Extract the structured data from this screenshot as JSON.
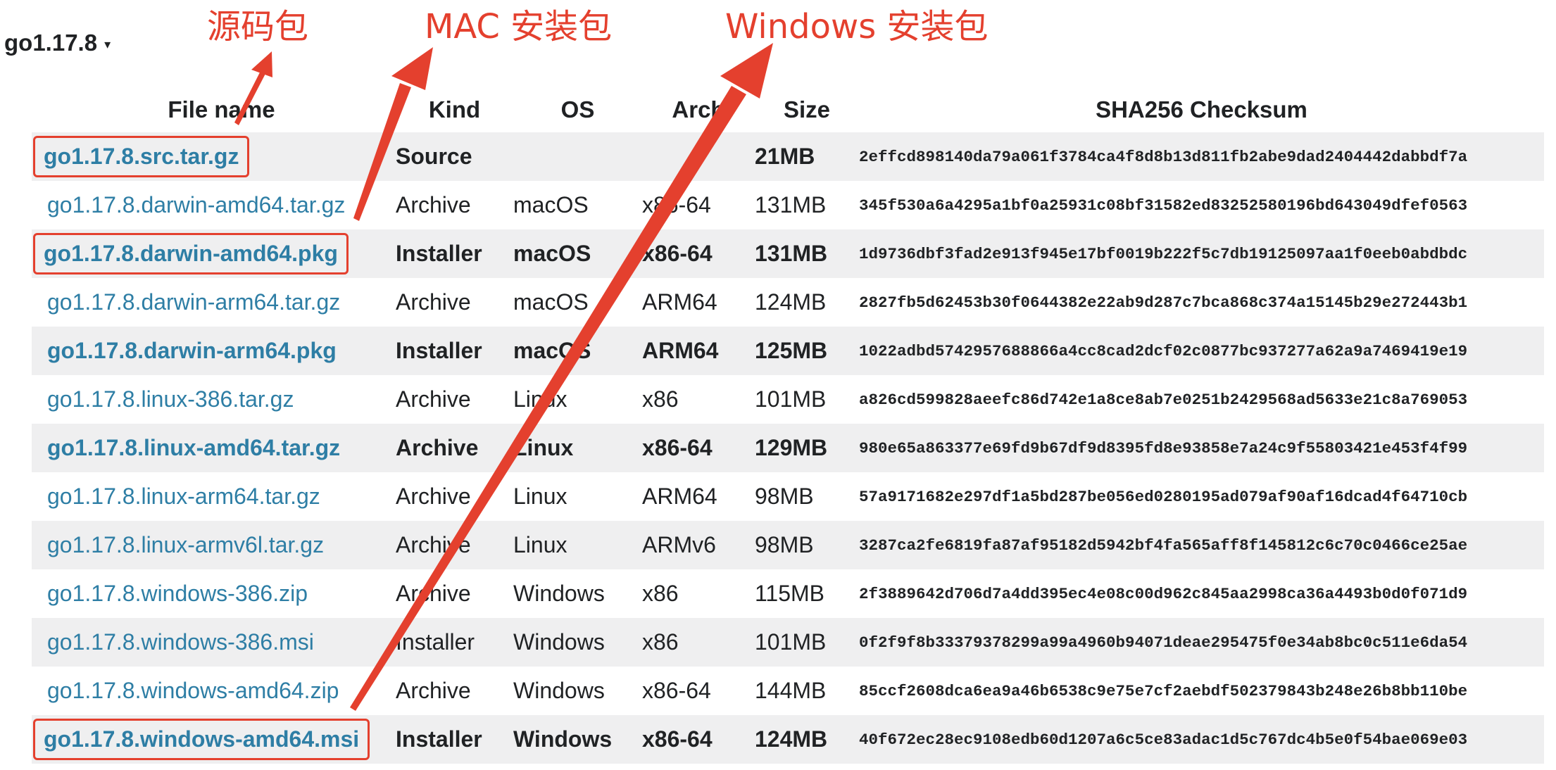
{
  "version": {
    "label": "go1.17.8",
    "caret": "▾"
  },
  "annotations": {
    "source_label": "源码包",
    "mac_label": "MAC 安装包",
    "windows_label": "Windows 安装包",
    "color": "#e4402e"
  },
  "table": {
    "headers": [
      "File name",
      "Kind",
      "OS",
      "Arch",
      "Size",
      "SHA256 Checksum"
    ],
    "rows": [
      {
        "file": "go1.17.8.src.tar.gz",
        "kind": "Source",
        "os": "",
        "arch": "",
        "size": "21MB",
        "sha": "2effcd898140da79a061f3784ca4f8d8b13d811fb2abe9dad2404442dabbdf7a"
      },
      {
        "file": "go1.17.8.darwin-amd64.tar.gz",
        "kind": "Archive",
        "os": "macOS",
        "arch": "x86-64",
        "size": "131MB",
        "sha": "345f530a6a4295a1bf0a25931c08bf31582ed83252580196bd643049dfef0563"
      },
      {
        "file": "go1.17.8.darwin-amd64.pkg",
        "kind": "Installer",
        "os": "macOS",
        "arch": "x86-64",
        "size": "131MB",
        "sha": "1d9736dbf3fad2e913f945e17bf0019b222f5c7db19125097aa1f0eeb0abdbdc"
      },
      {
        "file": "go1.17.8.darwin-arm64.tar.gz",
        "kind": "Archive",
        "os": "macOS",
        "arch": "ARM64",
        "size": "124MB",
        "sha": "2827fb5d62453b30f0644382e22ab9d287c7bca868c374a15145b29e272443b1"
      },
      {
        "file": "go1.17.8.darwin-arm64.pkg",
        "kind": "Installer",
        "os": "macOS",
        "arch": "ARM64",
        "size": "125MB",
        "sha": "1022adbd5742957688866a4cc8cad2dcf02c0877bc937277a62a9a7469419e19"
      },
      {
        "file": "go1.17.8.linux-386.tar.gz",
        "kind": "Archive",
        "os": "Linux",
        "arch": "x86",
        "size": "101MB",
        "sha": "a826cd599828aeefc86d742e1a8ce8ab7e0251b2429568ad5633e21c8a769053"
      },
      {
        "file": "go1.17.8.linux-amd64.tar.gz",
        "kind": "Archive",
        "os": "Linux",
        "arch": "x86-64",
        "size": "129MB",
        "sha": "980e65a863377e69fd9b67df9d8395fd8e93858e7a24c9f55803421e453f4f99"
      },
      {
        "file": "go1.17.8.linux-arm64.tar.gz",
        "kind": "Archive",
        "os": "Linux",
        "arch": "ARM64",
        "size": "98MB",
        "sha": "57a9171682e297df1a5bd287be056ed0280195ad079af90af16dcad4f64710cb"
      },
      {
        "file": "go1.17.8.linux-armv6l.tar.gz",
        "kind": "Archive",
        "os": "Linux",
        "arch": "ARMv6",
        "size": "98MB",
        "sha": "3287ca2fe6819fa87af95182d5942bf4fa565aff8f145812c6c70c0466ce25ae"
      },
      {
        "file": "go1.17.8.windows-386.zip",
        "kind": "Archive",
        "os": "Windows",
        "arch": "x86",
        "size": "115MB",
        "sha": "2f3889642d706d7a4dd395ec4e08c00d962c845aa2998ca36a4493b0d0f071d9"
      },
      {
        "file": "go1.17.8.windows-386.msi",
        "kind": "Installer",
        "os": "Windows",
        "arch": "x86",
        "size": "101MB",
        "sha": "0f2f9f8b33379378299a99a4960b94071deae295475f0e34ab8bc0c511e6da54"
      },
      {
        "file": "go1.17.8.windows-amd64.zip",
        "kind": "Archive",
        "os": "Windows",
        "arch": "x86-64",
        "size": "144MB",
        "sha": "85ccf2608dca6ea9a46b6538c9e75e7cf2aebdf502379843b248e26b8bb110be"
      },
      {
        "file": "go1.17.8.windows-amd64.msi",
        "kind": "Installer",
        "os": "Windows",
        "arch": "x86-64",
        "size": "124MB",
        "sha": "40f672ec28ec9108edb60d1207a6c5ce83adac1d5c767dc4b5e0f54bae069e03"
      }
    ]
  },
  "colors": {
    "link": "#2e7ea5",
    "stripe": "#efeff0",
    "annotation": "#e4402e",
    "text": "#202224"
  }
}
